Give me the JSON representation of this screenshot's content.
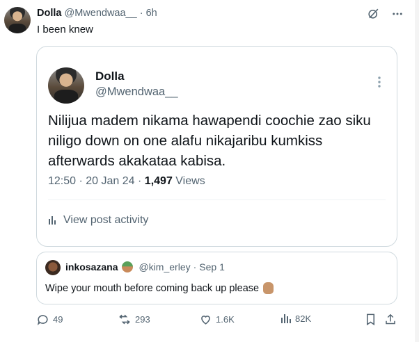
{
  "tweet": {
    "author_name": "Dolla",
    "author_handle": "@Mwendwaa__",
    "dot": "·",
    "time": "6h",
    "text": "I been knew"
  },
  "quoted": {
    "author_name": "Dolla",
    "author_handle": "@Mwendwaa__",
    "body": "Nilijua madem nikama hawapendi coochie zao siku niligo down on one alafu nikajaribu kumkiss afterwards akakataa kabisa.",
    "time": "12:50",
    "sep1": "·",
    "date": "20 Jan 24",
    "sep2": "·",
    "views_count": "1,497",
    "views_label": "Views",
    "activity_label": "View post activity"
  },
  "reply": {
    "author_name": "inkosazana",
    "author_handle": "@kim_erley",
    "dot": "·",
    "time": "Sep 1",
    "text": "Wipe your mouth before coming back up please"
  },
  "actions": {
    "replies": "49",
    "reposts": "293",
    "likes": "1.6K",
    "views": "82K"
  },
  "colors": {
    "text_primary": "#0f1419",
    "text_secondary": "#536471",
    "border": "#cfd9de"
  }
}
